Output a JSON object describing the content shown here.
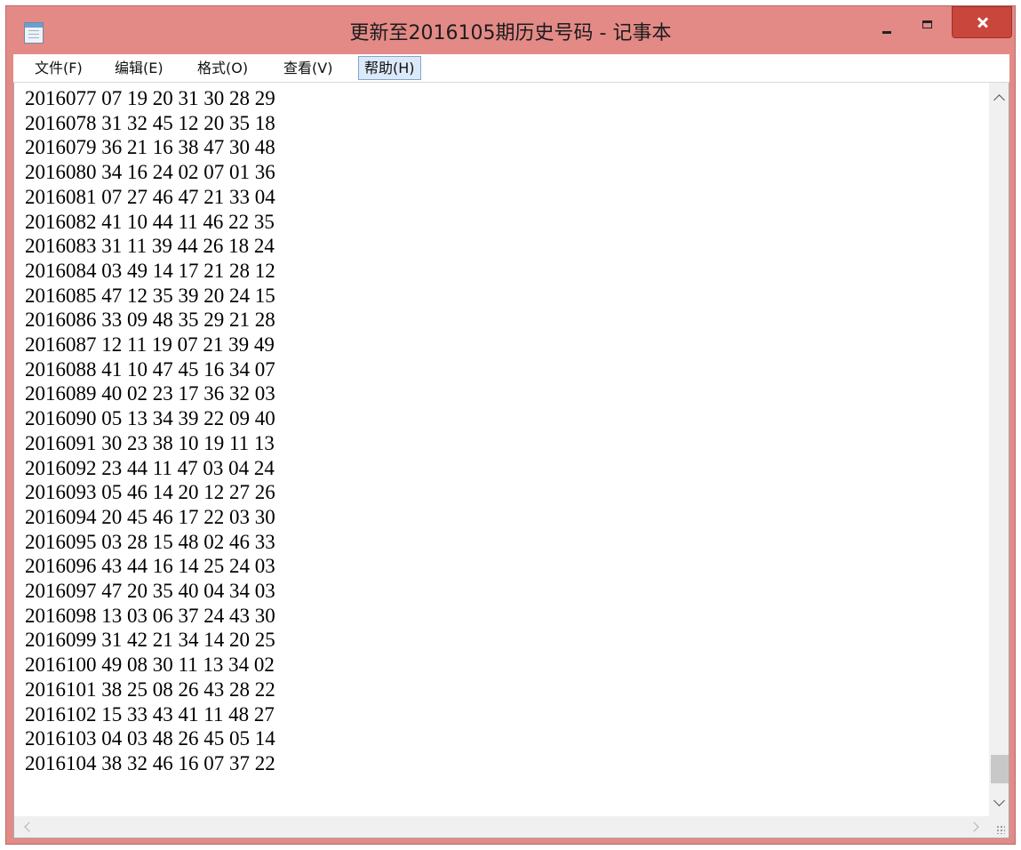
{
  "window": {
    "title": "更新至2016105期历史号码 - 记事本",
    "icons": {
      "app": "notepad-icon",
      "minimize": "minimize-icon",
      "maximize": "maximize-icon",
      "close": "close-icon"
    },
    "close_color": "#c9463d",
    "frame_color": "#e38a87"
  },
  "menu": {
    "items": [
      {
        "label": "文件(F)"
      },
      {
        "label": "编辑(E)"
      },
      {
        "label": "格式(O)"
      },
      {
        "label": "查看(V)"
      },
      {
        "label": "帮助(H)"
      }
    ],
    "selected": "帮助(H)"
  },
  "editor": {
    "lines": [
      "2016077 07 19 20 31 30 28 29",
      "2016078 31 32 45 12 20 35 18",
      "2016079 36 21 16 38 47 30 48",
      "2016080 34 16 24 02 07 01 36",
      "2016081 07 27 46 47 21 33 04",
      "2016082 41 10 44 11 46 22 35",
      "2016083 31 11 39 44 26 18 24",
      "2016084 03 49 14 17 21 28 12",
      "2016085 47 12 35 39 20 24 15",
      "2016086 33 09 48 35 29 21 28",
      "2016087 12 11 19 07 21 39 49",
      "2016088 41 10 47 45 16 34 07",
      "2016089 40 02 23 17 36 32 03",
      "2016090 05 13 34 39 22 09 40",
      "2016091 30 23 38 10 19 11 13",
      "2016092 23 44 11 47 03 04 24",
      "2016093 05 46 14 20 12 27 26",
      "2016094 20 45 46 17 22 03 30",
      "2016095 03 28 15 48 02 46 33",
      "2016096 43 44 16 14 25 24 03",
      "2016097 47 20 35 40 04 34 03",
      "2016098 13 03 06 37 24 43 30",
      "2016099 31 42 21 34 14 20 25",
      "2016100 49 08 30 11 13 34 02",
      "2016101 38 25 08 26 43 28 22",
      "2016102 15 33 43 41 11 48 27",
      "2016103 04 03 48 26 45 05 14",
      "2016104 38 32 46 16 07 37 22"
    ]
  }
}
